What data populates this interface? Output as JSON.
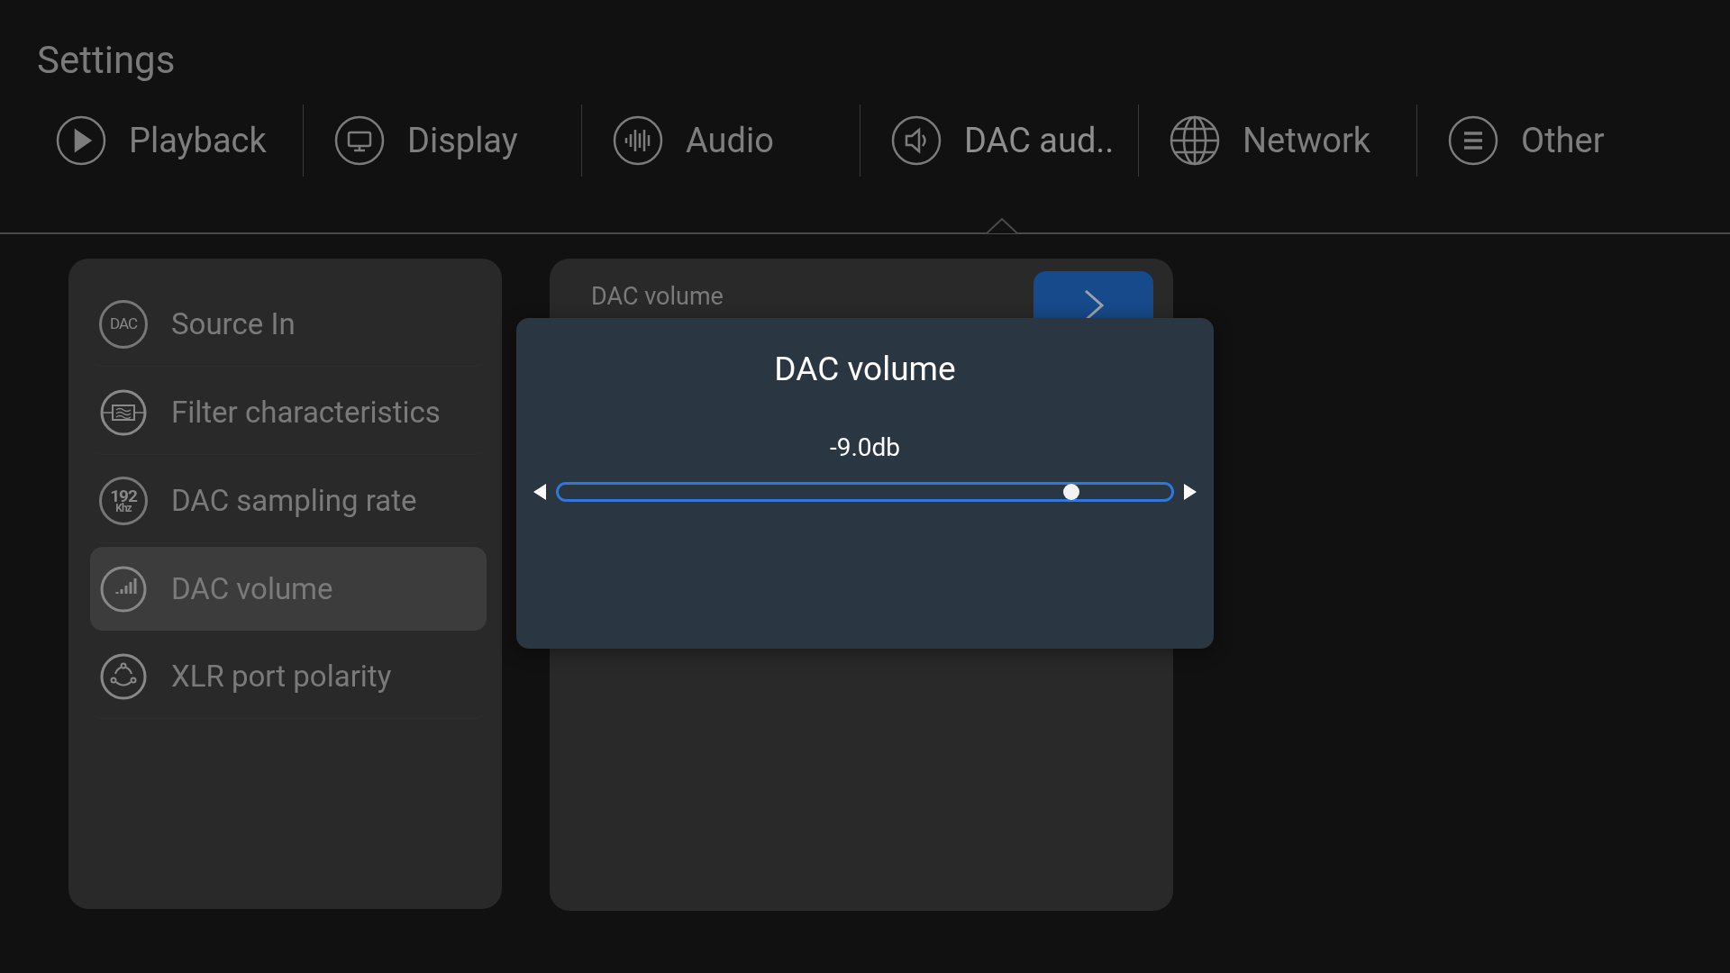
{
  "title": "Settings",
  "tabs": [
    {
      "label": "Playback",
      "kind": "play",
      "selected": false
    },
    {
      "label": "Display",
      "kind": "monitor",
      "selected": false
    },
    {
      "label": "Audio",
      "kind": "wave",
      "selected": false
    },
    {
      "label": "DAC aud..",
      "kind": "speaker",
      "selected": true
    },
    {
      "label": "Network",
      "kind": "globe",
      "selected": false
    },
    {
      "label": "Other",
      "kind": "list",
      "selected": false
    }
  ],
  "sidebar": {
    "items": [
      {
        "label": "Source In",
        "kind": "text",
        "icon_text": [
          "DAC"
        ],
        "selected": false
      },
      {
        "label": "Filter characteristics",
        "kind": "filter",
        "selected": false
      },
      {
        "label": "DAC sampling rate",
        "kind": "text",
        "icon_text": [
          "192",
          "Khz"
        ],
        "selected": false
      },
      {
        "label": "DAC volume",
        "kind": "volume",
        "selected": true
      },
      {
        "label": "XLR port polarity",
        "kind": "xlr",
        "selected": false
      }
    ]
  },
  "detail": {
    "label": "DAC volume"
  },
  "dialog": {
    "title": "DAC volume",
    "reading": "-9.0db",
    "level": 0.837
  }
}
